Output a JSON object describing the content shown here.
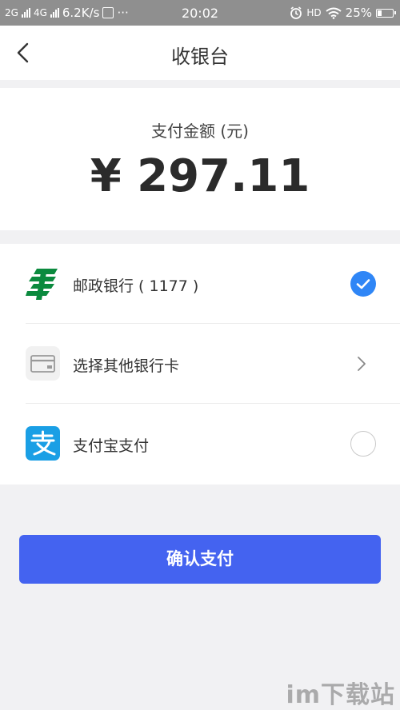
{
  "status_bar": {
    "net1": "2G",
    "net2": "4G",
    "speed": "6.2K/s",
    "dots": "···",
    "time": "20:02",
    "hd": "HD",
    "battery": "25%"
  },
  "header": {
    "title": "收银台"
  },
  "amount": {
    "label": "支付金额 (元)",
    "value": "¥ 297.11"
  },
  "payment_methods": [
    {
      "label": "邮政银行 ( 1177 )",
      "selected": true
    },
    {
      "label": "选择其他银行卡",
      "selected": false
    },
    {
      "label": "支付宝支付",
      "selected": false
    }
  ],
  "confirm": {
    "label": "确认支付"
  },
  "watermark": {
    "text": "im下载站"
  },
  "colors": {
    "accent": "#4463f0",
    "check": "#2f86f6",
    "postal_green": "#0b8a3e",
    "alipay_blue": "#1a9fe5",
    "status_bar": "#8f8f8f"
  }
}
